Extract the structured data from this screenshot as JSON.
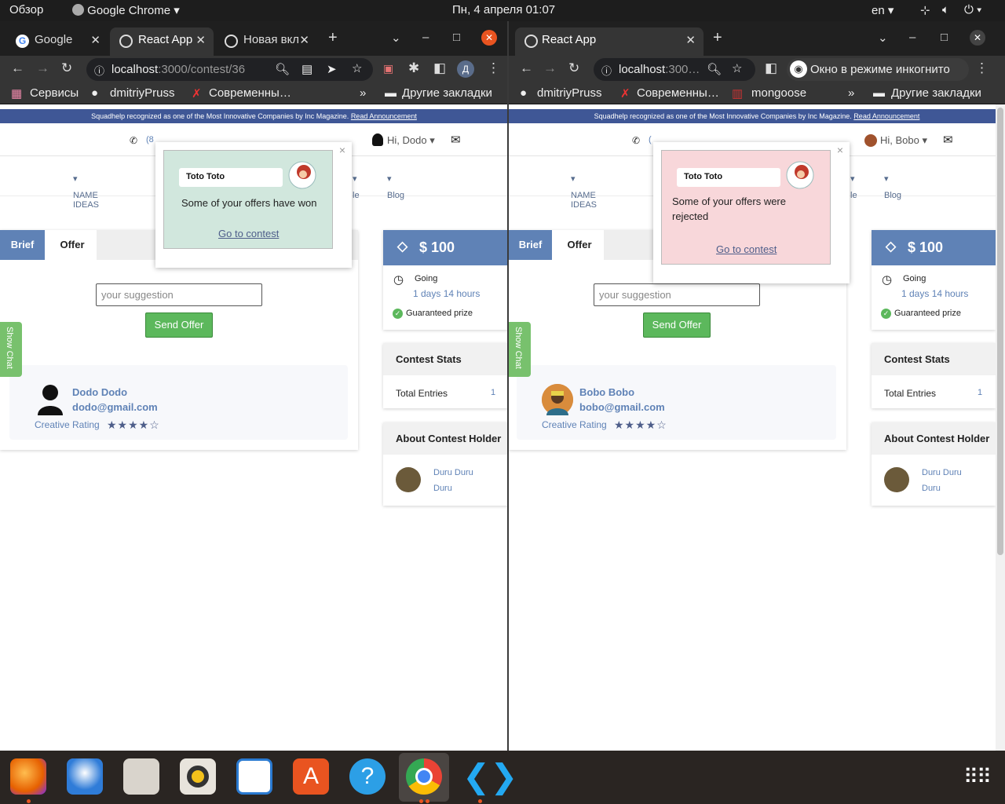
{
  "system_bar": {
    "overview": "Обзор",
    "app_name": "Google Chrome",
    "clock": "Пн, 4 апреля  01:07",
    "lang": "en"
  },
  "window_left": {
    "tabs": [
      {
        "label": "Google"
      },
      {
        "label": "React App"
      },
      {
        "label": "Новая вкл"
      }
    ],
    "url_host": "localhost",
    "url_path": ":3000/contest/36",
    "profile_letter": "Д",
    "bookmarks": [
      "Сервисы",
      "dmitriyPruss",
      "Современны…"
    ],
    "other_bookmarks": "Другие закладки",
    "greeting": "Hi, Dodo",
    "phone_partial": "(8",
    "nav": [
      "NAME IDEAS",
      "le",
      "Blog"
    ],
    "notification": {
      "sender": "Toto Toto",
      "message": "Some of your offers have won",
      "link": "Go to contest",
      "bg": "#d1e7dd"
    },
    "tab_brief": "Brief",
    "tab_offer": "Offer",
    "suggestion_placeholder": "your suggestion",
    "send_offer": "Send Offer",
    "show_chat": "Show Chat",
    "entry": {
      "name": "Dodo Dodo",
      "email": "dodo@gmail.com",
      "rating_label": "Creative Rating",
      "stars": "★★★★☆"
    },
    "prize": "$ 100",
    "status": "Going",
    "time_left": "1 days 14 hours",
    "guaranteed": "Guaranteed prize",
    "stats_title": "Contest Stats",
    "total_entries_label": "Total Entries",
    "total_entries_value": "1",
    "holder_title": "About Contest Holder",
    "holder_name_1": "Duru Duru",
    "holder_name_2": "Duru"
  },
  "window_right": {
    "tabs": [
      {
        "label": "React App"
      }
    ],
    "url_host": "localhost",
    "url_path": ":300…",
    "incognito": "Окно в режиме инкогнито",
    "bookmarks": [
      "dmitriyPruss",
      "Современны…",
      "mongoose"
    ],
    "other_bookmarks": "Другие закладки",
    "greeting": "Hi, Bobo",
    "phone_partial": "(",
    "nav": [
      "NAME IDEAS",
      "le",
      "Blog"
    ],
    "notification": {
      "sender": "Toto Toto",
      "message": "Some of your offers were rejected",
      "link": "Go to contest",
      "bg": "#f8d7da"
    },
    "tab_brief": "Brief",
    "tab_offer": "Offer",
    "suggestion_placeholder": "your suggestion",
    "send_offer": "Send Offer",
    "show_chat": "Show Chat",
    "entry": {
      "name": "Bobo Bobo",
      "email": "bobo@gmail.com",
      "rating_label": "Creative Rating",
      "stars": "★★★★☆"
    },
    "prize": "$ 100",
    "status": "Going",
    "time_left": "1 days 14 hours",
    "guaranteed": "Guaranteed prize",
    "stats_title": "Contest Stats",
    "total_entries_label": "Total Entries",
    "total_entries_value": "1",
    "holder_title": "About Contest Holder",
    "holder_name_1": "Duru Duru",
    "holder_name_2": "Duru"
  },
  "banner": {
    "text": "Squadhelp recognized as one of the Most Innovative Companies by Inc Magazine.",
    "link": "Read Announcement"
  },
  "dock": [
    "firefox-icon",
    "thunderbird-icon",
    "files-icon",
    "rhythmbox-icon",
    "writer-icon",
    "app-center-icon",
    "help-icon",
    "chrome-icon",
    "vscode-icon",
    "app-grid-icon"
  ],
  "colors": {
    "accent": "#5f82b6",
    "green": "#5cb85c",
    "banner": "#3f5796"
  }
}
